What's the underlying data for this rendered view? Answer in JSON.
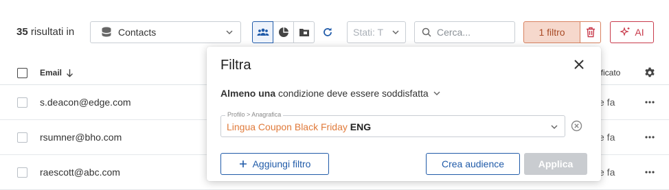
{
  "toolbar": {
    "result_count": "35",
    "result_suffix": "risultati in",
    "source": "Contacts",
    "states_placeholder": "Stati: T",
    "search_placeholder": "Cerca...",
    "filter_label": "1 filtro",
    "ai_label": "AI"
  },
  "table": {
    "col_email": "Email",
    "col_modified": "ificato",
    "rows": [
      {
        "email": "s.deacon@edge.com",
        "time": "e fa"
      },
      {
        "email": "rsumner@bho.com",
        "time": "e fa"
      },
      {
        "email": "raescott@abc.com",
        "time": "e fa"
      }
    ]
  },
  "modal": {
    "title": "Filtra",
    "condition_bold": "Almeno una",
    "condition_rest": "condizione deve essere soddisfatta",
    "field_label": "Profilo > Anagrafica",
    "field_value_attr": "Lingua Coupon Black Friday",
    "field_value_val": "ENG",
    "add_filter": "Aggiungi filtro",
    "create_audience": "Crea audience",
    "apply": "Applica"
  },
  "colors": {
    "primary": "#1f5aa8",
    "filter_accent": "#d8815f",
    "ai_accent": "#c8394a",
    "attr_orange": "#e07a3a"
  }
}
